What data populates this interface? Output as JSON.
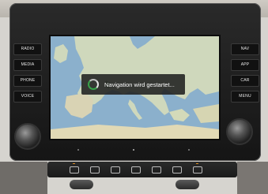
{
  "left_buttons": [
    {
      "label": "RADIO"
    },
    {
      "label": "MEDIA"
    },
    {
      "label": "PHONE"
    },
    {
      "label": "VOICE"
    }
  ],
  "right_buttons": [
    {
      "label": "NAV"
    },
    {
      "label": "APP"
    },
    {
      "label": "CAR"
    },
    {
      "label": "MENU"
    }
  ],
  "screen": {
    "toast_message": "Navigation wird gestartet..."
  },
  "colors": {
    "sea": "#8bb0cc",
    "land": "#cfd8bc",
    "spinner_accent": "#37a24a",
    "climate_led": "#d98a1f"
  }
}
